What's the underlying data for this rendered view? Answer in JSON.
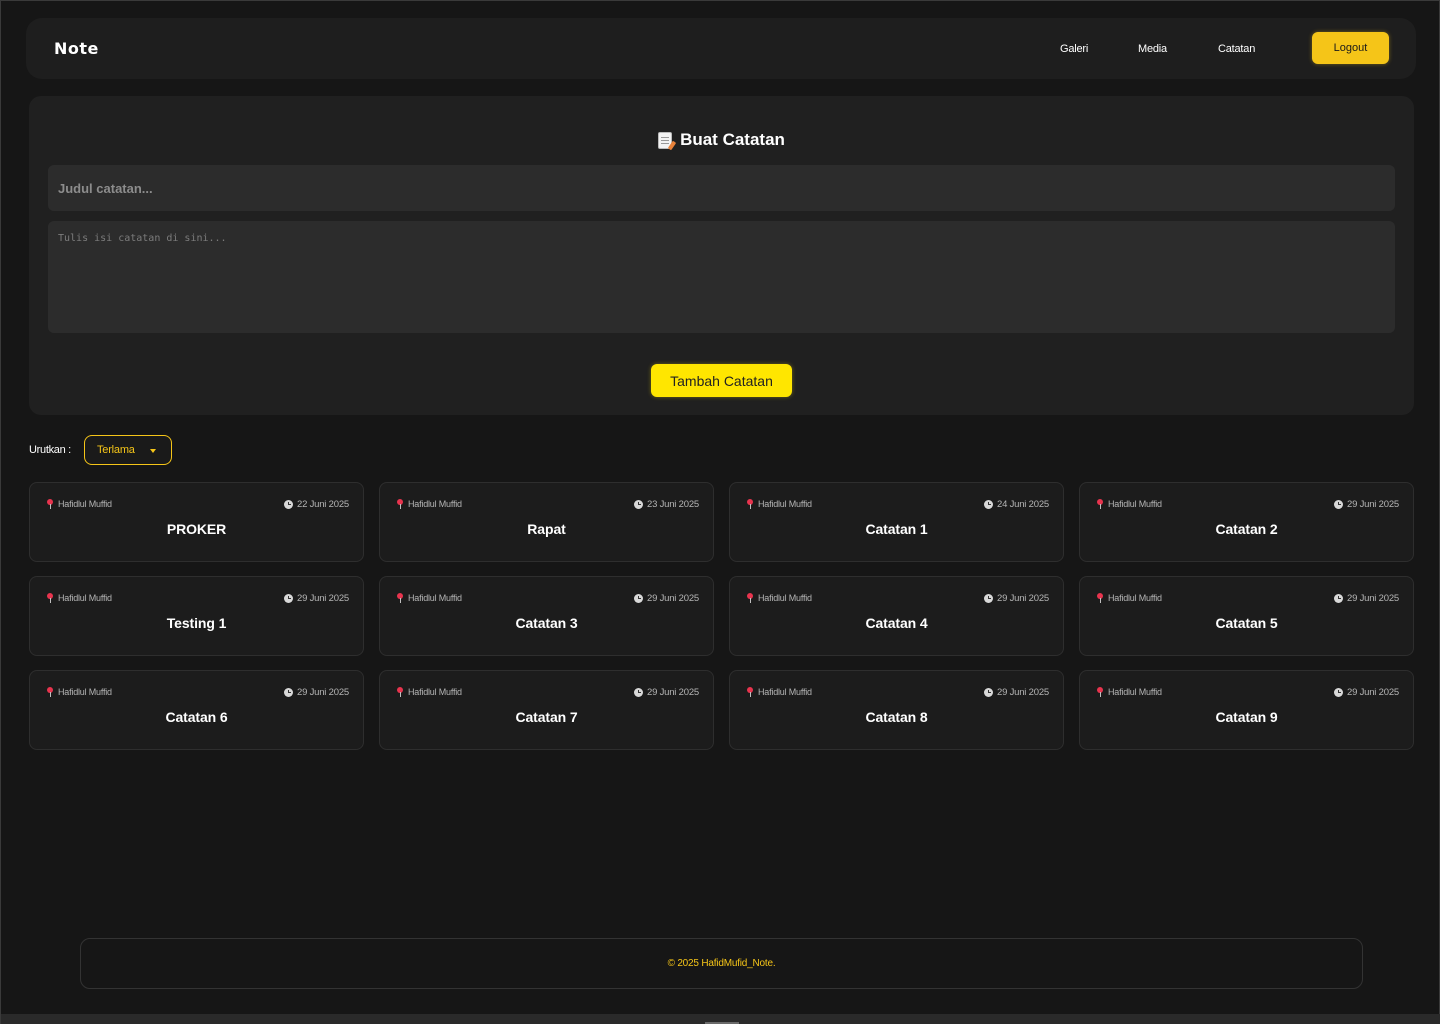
{
  "navbar": {
    "brand": "Note",
    "links": [
      "Galeri",
      "Media",
      "Catatan"
    ],
    "logout_label": "Logout"
  },
  "create": {
    "heading": "Buat Catatan",
    "heading_icon": "memo-icon",
    "title_placeholder": "Judul catatan...",
    "body_placeholder": "Tulis isi catatan di sini...",
    "submit_label": "Tambah Catatan"
  },
  "sort": {
    "label": "Urutkan :",
    "selected": "Terlama"
  },
  "notes": [
    {
      "author": "Hafidlul Muffid",
      "date": "22 Juni 2025",
      "title": "PROKER"
    },
    {
      "author": "Hafidlul Muffid",
      "date": "23 Juni 2025",
      "title": "Rapat"
    },
    {
      "author": "Hafidlul Muffid",
      "date": "24 Juni 2025",
      "title": "Catatan 1"
    },
    {
      "author": "Hafidlul Muffid",
      "date": "29 Juni 2025",
      "title": "Catatan 2"
    },
    {
      "author": "Hafidlul Muffid",
      "date": "29 Juni 2025",
      "title": "Testing 1"
    },
    {
      "author": "Hafidlul Muffid",
      "date": "29 Juni 2025",
      "title": "Catatan 3"
    },
    {
      "author": "Hafidlul Muffid",
      "date": "29 Juni 2025",
      "title": "Catatan 4"
    },
    {
      "author": "Hafidlul Muffid",
      "date": "29 Juni 2025",
      "title": "Catatan 5"
    },
    {
      "author": "Hafidlul Muffid",
      "date": "29 Juni 2025",
      "title": "Catatan 6"
    },
    {
      "author": "Hafidlul Muffid",
      "date": "29 Juni 2025",
      "title": "Catatan 7"
    },
    {
      "author": "Hafidlul Muffid",
      "date": "29 Juni 2025",
      "title": "Catatan 8"
    },
    {
      "author": "Hafidlul Muffid",
      "date": "29 Juni 2025",
      "title": "Catatan 9"
    }
  ],
  "footer": {
    "text": "© 2025 HafidMufid_Note."
  },
  "colors": {
    "background": "#161616",
    "panel": "#202020",
    "accent": "#f5c518",
    "button": "#ffe600",
    "pin": "#e8344e"
  }
}
